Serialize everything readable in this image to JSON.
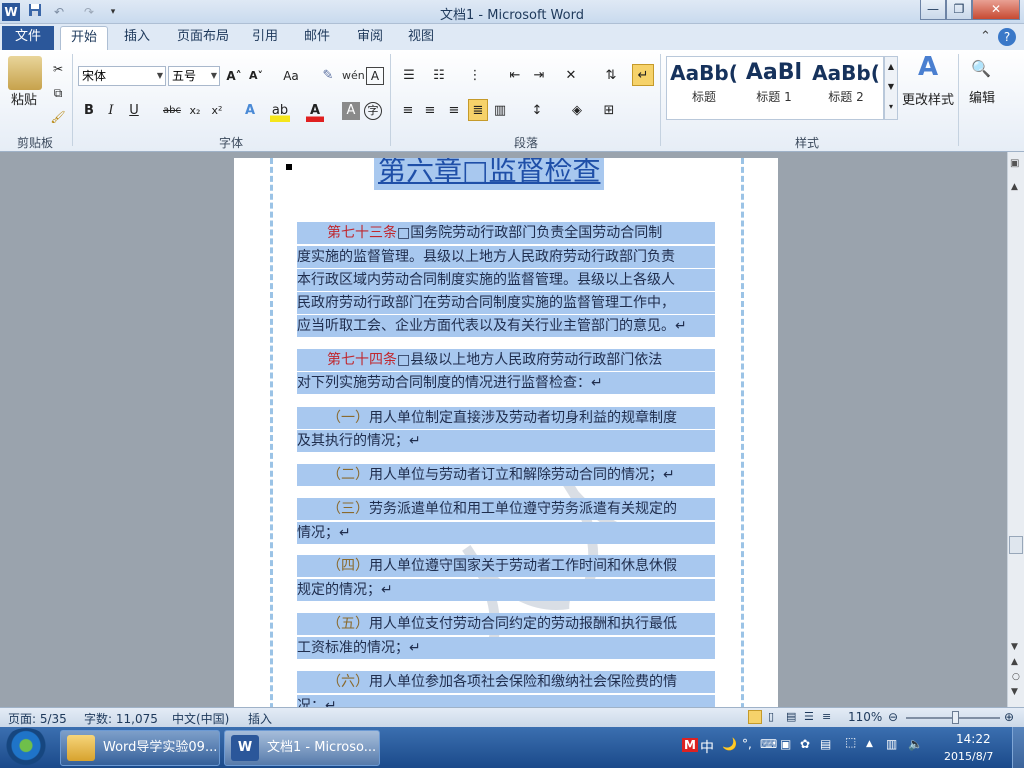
{
  "window": {
    "title": "文档1 - Microsoft Word",
    "word_icon": "W",
    "minimize": "—",
    "restore": "❐",
    "close": "✕"
  },
  "qat": {
    "save_icon": "save-icon",
    "undo_icon": "undo-icon",
    "redo_icon": "redo-icon"
  },
  "tabs": [
    "文件",
    "开始",
    "插入",
    "页面布局",
    "引用",
    "邮件",
    "审阅",
    "视图"
  ],
  "ribbon": {
    "clipboard": {
      "paste": "粘贴",
      "label": "剪贴板"
    },
    "font": {
      "name": "宋体",
      "size": "五号",
      "label": "字体",
      "bold": "B",
      "italic": "I",
      "underline": "U",
      "strike": "abc",
      "sub": "x₂",
      "sup": "x²",
      "grow": "A˄",
      "shrink": "A˅",
      "case": "Aa",
      "clear": "A"
    },
    "paragraph": {
      "label": "段落"
    },
    "styles": {
      "label": "样式",
      "items": [
        {
          "preview": "AaBb(",
          "name": "标题"
        },
        {
          "preview": "AaBl",
          "name": "标题 1"
        },
        {
          "preview": "AaBb(",
          "name": "标题 2"
        }
      ],
      "change": "更改样式"
    },
    "editing": {
      "label": "编辑"
    }
  },
  "document": {
    "chapter": "第六章□监督检查",
    "lines": [
      {
        "pre": "第七十三条",
        "text": "□国务院劳动行政部门负责全国劳动合同制"
      },
      {
        "pre": "",
        "text": "度实施的监督管理。县级以上地方人民政府劳动行政部门负责"
      },
      {
        "pre": "",
        "text": "本行政区域内劳动合同制度实施的监督管理。县级以上各级人"
      },
      {
        "pre": "",
        "text": "民政府劳动行政部门在劳动合同制度实施的监督管理工作中，"
      },
      {
        "pre": "",
        "text": "应当听取工会、企业方面代表以及有关行业主管部门的意见。↵"
      },
      {
        "pre": "第七十四条",
        "text": "□县级以上地方人民政府劳动行政部门依法"
      },
      {
        "pre": "",
        "text": "对下列实施劳动合同制度的情况进行监督检查：↵"
      },
      {
        "pre": "（一）",
        "text": "用人单位制定直接涉及劳动者切身利益的规章制度"
      },
      {
        "pre": "",
        "text": "及其执行的情况；↵"
      },
      {
        "pre": "（二）",
        "text": "用人单位与劳动者订立和解除劳动合同的情况；↵"
      },
      {
        "pre": "（三）",
        "text": "劳务派遣单位和用工单位遵守劳务派遣有关规定的"
      },
      {
        "pre": "",
        "text": "情况；↵"
      },
      {
        "pre": "（四）",
        "text": "用人单位遵守国家关于劳动者工作时间和休息休假"
      },
      {
        "pre": "",
        "text": "规定的情况；↵"
      },
      {
        "pre": "（五）",
        "text": "用人单位支付劳动合同约定的劳动报酬和执行最低"
      },
      {
        "pre": "",
        "text": "工资标准的情况；↵"
      },
      {
        "pre": "（六）",
        "text": "用人单位参加各项社会保险和缴纳社会保险费的情"
      },
      {
        "pre": "",
        "text": "况；↵"
      }
    ]
  },
  "status": {
    "page": "页面: 5/35",
    "words": "字数: 11,075",
    "lang": "中文(中国)",
    "mode": "插入",
    "zoom": "110%"
  },
  "taskbar": {
    "items": [
      "Word导学实验09...",
      "文档1 - Microso..."
    ],
    "time": "14:22",
    "date": "2015/8/7",
    "ime": "中"
  }
}
